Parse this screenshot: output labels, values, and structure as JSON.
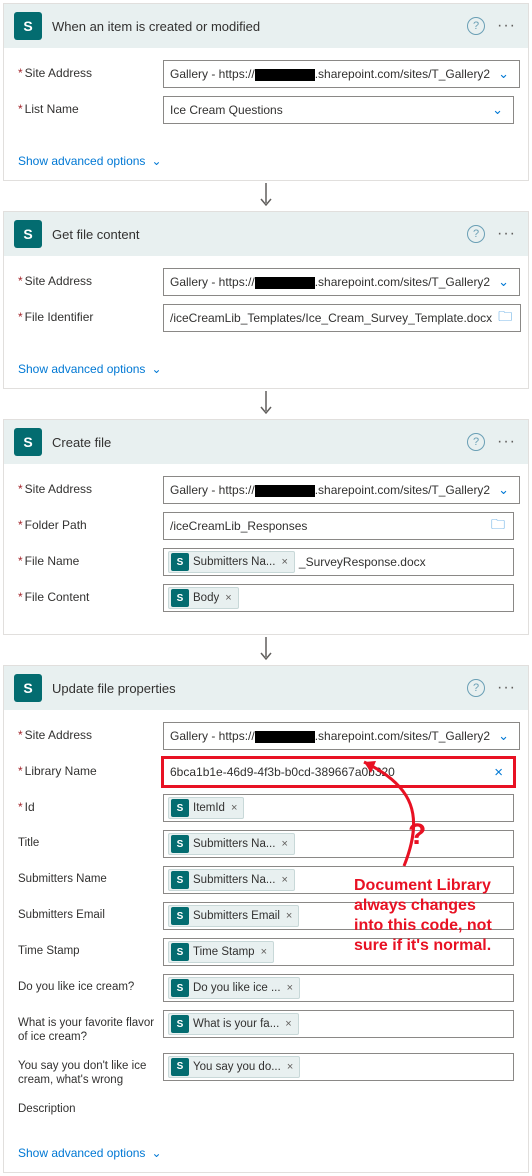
{
  "cards": {
    "trigger": {
      "title": "When an item is created or modified",
      "siteLabel": "Site Address",
      "sitePrefix": "Gallery - https://",
      "siteSuffix": ".sharepoint.com/sites/T_Gallery2",
      "listNameLabel": "List Name",
      "listName": "Ice Cream Questions",
      "advanced": "Show advanced options"
    },
    "getFile": {
      "title": "Get file content",
      "siteLabel": "Site Address",
      "sitePrefix": "Gallery - https://",
      "siteSuffix": ".sharepoint.com/sites/T_Gallery2",
      "fileIdLabel": "File Identifier",
      "fileId": "/iceCreamLib_Templates/Ice_Cream_Survey_Template.docx",
      "advanced": "Show advanced options"
    },
    "createFile": {
      "title": "Create file",
      "siteLabel": "Site Address",
      "sitePrefix": "Gallery - https://",
      "siteSuffix": ".sharepoint.com/sites/T_Gallery2",
      "folderLabel": "Folder Path",
      "folderPath": "/iceCreamLib_Responses",
      "fileNameLabel": "File Name",
      "fileNameToken": "Submitters Na...",
      "fileNameSuffix": "_SurveyResponse.docx",
      "fileContentLabel": "File Content",
      "fileContentToken": "Body"
    },
    "updateProps": {
      "title": "Update file properties",
      "siteLabel": "Site Address",
      "sitePrefix": "Gallery - https://",
      "siteSuffix": ".sharepoint.com/sites/T_Gallery2",
      "libLabel": "Library Name",
      "libValue": "6bca1b1e-46d9-4f3b-b0cd-389667a0b320",
      "idLabel": "Id",
      "idToken": "ItemId",
      "titleLabel": "Title",
      "titleToken": "Submitters Na...",
      "subNameLabel": "Submitters Name",
      "subNameToken": "Submitters Na...",
      "subEmailLabel": "Submitters Email",
      "subEmailToken": "Submitters Email",
      "timeLabel": "Time Stamp",
      "timeToken": "Time Stamp",
      "q1Label": "Do you like ice cream?",
      "q1Token": "Do you like ice ...",
      "q2Label": "What is your favorite flavor of ice cream?",
      "q2Token": "What is your fa...",
      "q3Label": "You say you don't like ice cream, what's wrong",
      "q3Token": "You say you do...",
      "descLabel": "Description",
      "advanced": "Show advanced options"
    }
  },
  "annotation": {
    "line1": "Document Library",
    "line2": "always changes",
    "line3": "into this code, not",
    "line4": "sure if it's normal.",
    "qmark": "?"
  }
}
